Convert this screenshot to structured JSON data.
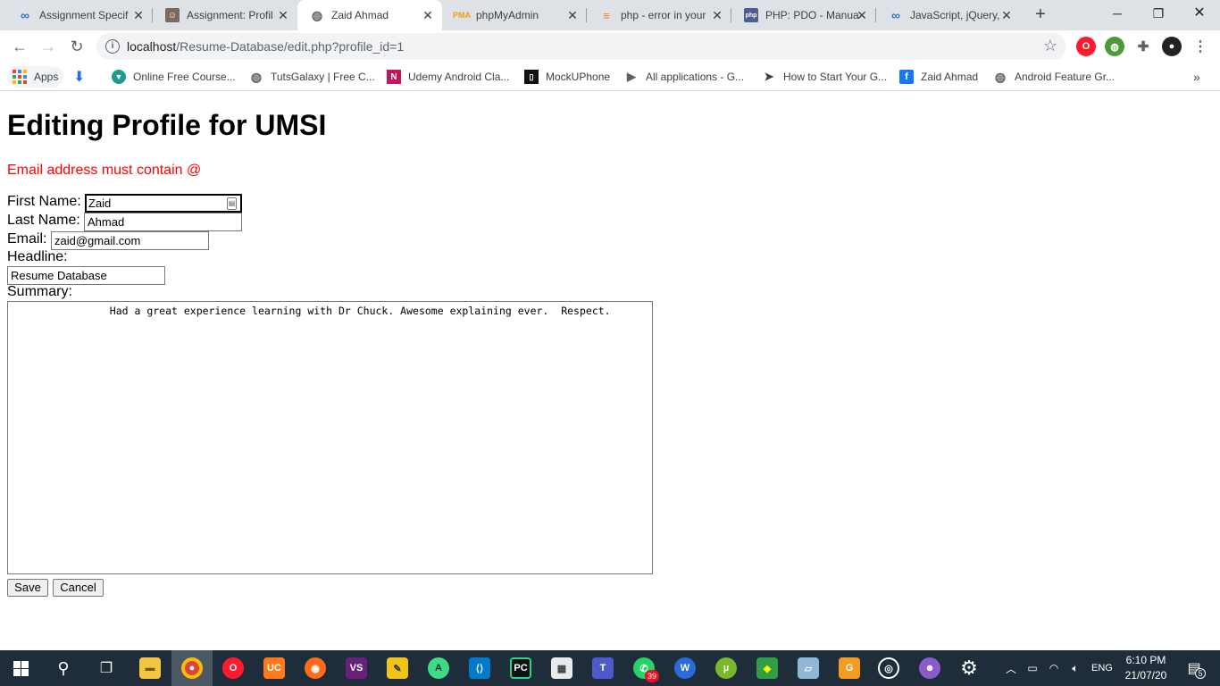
{
  "tabs": [
    {
      "title": "Assignment Specif",
      "icon": "coursera-infinity-icon",
      "color": "#2a73cc",
      "active": false
    },
    {
      "title": "Assignment: Profil",
      "icon": "avatar-icon",
      "color": "#7a6a5c",
      "active": false
    },
    {
      "title": "Zaid Ahmad",
      "icon": "globe-icon",
      "color": "#5f6368",
      "active": true
    },
    {
      "title": "phpMyAdmin",
      "icon": "phpmyadmin-icon",
      "color": "#f89c0e",
      "active": false
    },
    {
      "title": "php - error in your",
      "icon": "stackoverflow-icon",
      "color": "#f48024",
      "active": false
    },
    {
      "title": "PHP: PDO - Manua",
      "icon": "php-icon",
      "color": "#4f5b93",
      "active": false
    },
    {
      "title": "JavaScript, jQuery,",
      "icon": "coursera-infinity-icon",
      "color": "#2a73cc",
      "active": false
    }
  ],
  "window": {
    "minimize": "─",
    "restore": "❐",
    "close": "✕",
    "new_tab": "+"
  },
  "omnibox": {
    "host": "localhost",
    "path": "/Resume-Database/edit.php?profile_id=1"
  },
  "bookmarks": [
    {
      "label": "Apps",
      "icon": "apps-grid-icon"
    },
    {
      "label": "",
      "icon": "download-icon"
    },
    {
      "label": "Online Free Course...",
      "icon": "course-icon"
    },
    {
      "label": "TutsGalaxy | Free C...",
      "icon": "globe-icon"
    },
    {
      "label": "Udemy Android Cla...",
      "icon": "udemy-icon"
    },
    {
      "label": "MockUPhone",
      "icon": "mockuphone-icon"
    },
    {
      "label": "All applications - G...",
      "icon": "play-console-icon"
    },
    {
      "label": "How to Start Your G...",
      "icon": "send-icon"
    },
    {
      "label": "Zaid Ahmad",
      "icon": "facebook-icon"
    },
    {
      "label": "Android Feature Gr...",
      "icon": "globe-icon"
    }
  ],
  "page": {
    "heading": "Editing Profile for UMSI",
    "error": "Email address must contain @",
    "first_name_label": "First Name:",
    "first_name_value": "Zaid",
    "last_name_label": "Last Name:",
    "last_name_value": "Ahmad",
    "email_label": "Email:",
    "email_value": "zaid@gmail.com",
    "headline_label": "Headline:",
    "headline_value": "Resume Database",
    "summary_label": "Summary:",
    "summary_value": "                Had a great experience learning with Dr Chuck. Awesome explaining ever.  Respect.",
    "save_label": "Save",
    "cancel_label": "Cancel"
  },
  "taskbar": {
    "apps": [
      {
        "name": "windows-start-icon"
      },
      {
        "name": "search-icon"
      },
      {
        "name": "task-view-icon"
      },
      {
        "name": "file-explorer-icon"
      },
      {
        "name": "chrome-icon"
      },
      {
        "name": "opera-icon"
      },
      {
        "name": "uc-browser-icon"
      },
      {
        "name": "firefox-icon"
      },
      {
        "name": "visual-studio-icon"
      },
      {
        "name": "xampp-icon"
      },
      {
        "name": "android-studio-icon"
      },
      {
        "name": "vscode-icon"
      },
      {
        "name": "pycharm-icon"
      },
      {
        "name": "app-icon"
      },
      {
        "name": "teams-icon"
      },
      {
        "name": "whatsapp-icon"
      },
      {
        "name": "wps-writer-icon"
      },
      {
        "name": "utorrent-icon"
      },
      {
        "name": "app-icon"
      },
      {
        "name": "app-icon"
      },
      {
        "name": "pdf-icon"
      },
      {
        "name": "obs-icon"
      },
      {
        "name": "app-icon"
      },
      {
        "name": "settings-gear-icon"
      }
    ],
    "whatsapp_badge": "39",
    "language": "ENG",
    "time": "6:10 PM",
    "date": "21/07/20",
    "notification_count": "5"
  }
}
